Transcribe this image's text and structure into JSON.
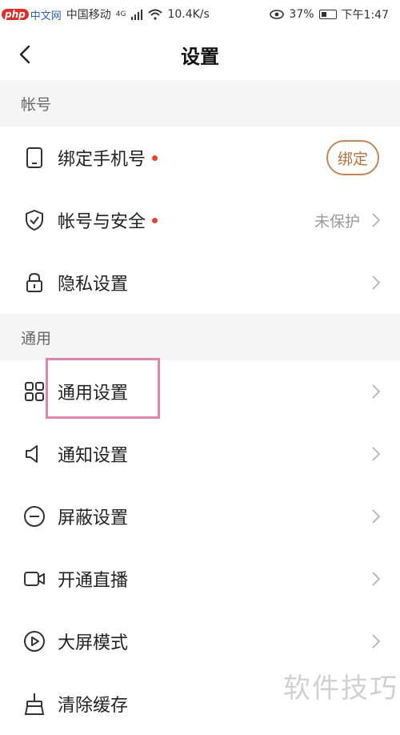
{
  "status_bar": {
    "site_logo": "php",
    "site_logo_text": "中文网",
    "carrier": "中国移动",
    "network": "4G",
    "speed": "10.4K/s",
    "battery": "37%",
    "time": "下午1:47"
  },
  "header": {
    "title": "设置"
  },
  "sections": {
    "account": "帐号",
    "general": "通用"
  },
  "rows": {
    "bind_phone": {
      "label": "绑定手机号",
      "action": "绑定"
    },
    "account_security": {
      "label": "帐号与安全",
      "status": "未保护"
    },
    "privacy": {
      "label": "隐私设置"
    },
    "general_settings": {
      "label": "通用设置"
    },
    "notification": {
      "label": "通知设置"
    },
    "block": {
      "label": "屏蔽设置"
    },
    "live": {
      "label": "开通直播"
    },
    "big_screen": {
      "label": "大屏模式"
    },
    "clear_cache": {
      "label": "清除缓存"
    }
  },
  "watermark": "软件技巧",
  "colors": {
    "accent": "#c48655",
    "dot": "#e0452f",
    "highlight": "#e085b0"
  }
}
